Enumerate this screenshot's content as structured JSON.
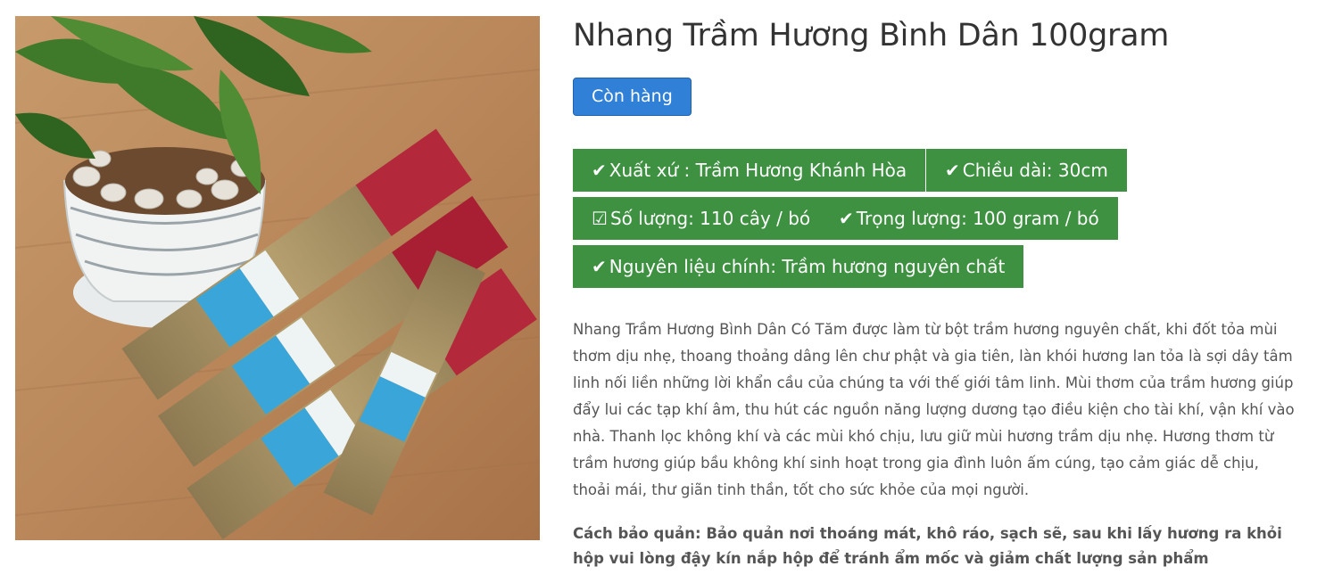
{
  "product": {
    "title": "Nhang Trầm Hương Bình Dân 100gram",
    "stock_label": "Còn hàng",
    "image_alt": "product-photo",
    "attributes": [
      {
        "icon": "check-icon",
        "glyph": "✔",
        "text": "Xuất xứ : Trầm Hương Khánh Hòa"
      },
      {
        "icon": "check-icon",
        "glyph": "✔",
        "text": "Chiều dài: 30cm"
      },
      {
        "icon": "checkbox-icon",
        "glyph": "☑",
        "text": "Số lượng: 110 cây / bó"
      },
      {
        "icon": "check-icon",
        "glyph": "✔",
        "text": "Trọng lượng: 100 gram / bó"
      },
      {
        "icon": "check-icon",
        "glyph": "✔",
        "text": "Nguyên liệu chính: Trầm hương nguyên chất"
      }
    ],
    "description": "Nhang Trầm Hương Bình Dân Có Tăm được làm từ bột trầm hương nguyên chất, khi đốt tỏa mùi thơm dịu nhẹ, thoang thoảng dâng lên chư phật và gia tiên, làn khói hương lan tỏa là sợi dây tâm linh nối liền những lời khẩn cầu của chúng ta với thế giới tâm linh. Mùi thơm của trầm hương giúp đẩy lui các tạp khí âm, thu hút các nguồn năng lượng dương tạo điều kiện cho tài khí, vận khí vào nhà. Thanh lọc không khí và các mùi khó chịu, lưu giữ mùi hương trầm dịu nhẹ. Hương thơm từ trầm hương giúp bầu không khí sinh hoạt trong gia đình luôn ấm cúng, tạo cảm giác dễ chịu, thoải mái, thư giãn tinh thần, tốt cho sức khỏe của mọi người.",
    "storage_note": "Cách bảo quản: Bảo quản nơi thoáng mát, khô ráo, sạch sẽ, sau khi lấy hương ra khỏi hộp vui lòng đậy kín nắp hộp để tránh ẩm mốc và giảm chất lượng sản phẩm"
  },
  "colors": {
    "stock_button": "#2f80d6",
    "attribute_badge": "#3d9140",
    "text": "#555555"
  }
}
